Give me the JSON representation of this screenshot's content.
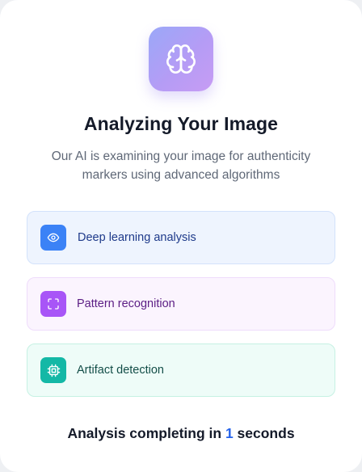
{
  "header": {
    "logo_icon": "brain-icon",
    "title": "Analyzing Your Image",
    "subtitle": "Our AI is examining your image for authenticity markers using advanced algorithms"
  },
  "steps": [
    {
      "label": "Deep learning analysis",
      "icon": "eye-icon",
      "accent": "#3b82f6"
    },
    {
      "label": "Pattern recognition",
      "icon": "scan-icon",
      "accent": "#a855f7"
    },
    {
      "label": "Artifact detection",
      "icon": "cpu-icon",
      "accent": "#14b8a6"
    }
  ],
  "footer": {
    "prefix": "Analysis completing in",
    "seconds": "1",
    "suffix": "seconds"
  },
  "colors": {
    "accent_blue": "#2563eb",
    "logo_gradient_start": "#9aa8f8",
    "logo_gradient_end": "#c79cf4"
  }
}
